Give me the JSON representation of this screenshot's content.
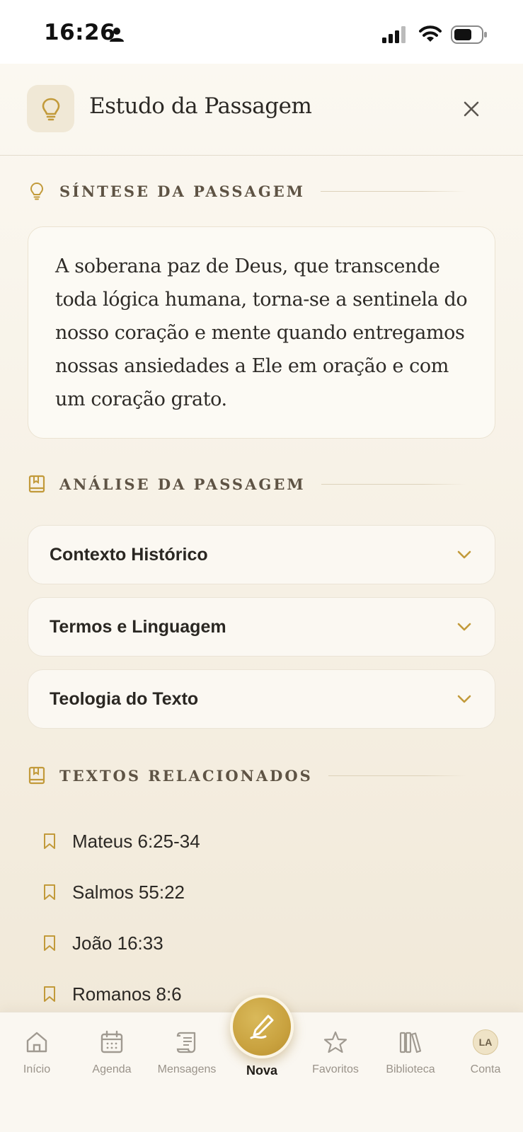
{
  "status_bar": {
    "time": "16:26"
  },
  "header": {
    "title": "Estudo da Passagem",
    "icon": "lightbulb-icon"
  },
  "synthesis": {
    "section_title": "SÍNTESE DA PASSAGEM",
    "icon": "lightbulb-icon",
    "text": "A soberana paz de Deus, que transcende toda lógica humana, torna-se a sentinela do nosso coração e mente quando entregamos nossas ansiedades a Ele em oração e com um coração grato."
  },
  "analysis": {
    "section_title": "ANÁLISE DA PASSAGEM",
    "icon": "book-icon",
    "items": [
      {
        "label": "Contexto Histórico"
      },
      {
        "label": "Termos e Linguagem"
      },
      {
        "label": "Teologia do Texto"
      }
    ]
  },
  "related": {
    "section_title": "TEXTOS RELACIONADOS",
    "icon": "book-icon",
    "items": [
      {
        "label": "Mateus 6:25-34"
      },
      {
        "label": "Salmos 55:22"
      },
      {
        "label": "João 16:33"
      },
      {
        "label": "Romanos 8:6"
      }
    ]
  },
  "bottom_nav": {
    "items": [
      {
        "label": "Início",
        "icon": "home-icon"
      },
      {
        "label": "Agenda",
        "icon": "calendar-icon"
      },
      {
        "label": "Mensagens",
        "icon": "scroll-icon"
      },
      {
        "label": "Nova",
        "icon": "pen-icon",
        "active": true
      },
      {
        "label": "Favoritos",
        "icon": "star-icon"
      },
      {
        "label": "Biblioteca",
        "icon": "library-icon"
      },
      {
        "label": "Conta",
        "icon": "avatar",
        "initials": "LA"
      }
    ]
  },
  "colors": {
    "accent_gold": "#c9a23f",
    "background": "#f4eee2",
    "text_dark": "#2b2824",
    "nav_inactive": "#9a938a"
  }
}
